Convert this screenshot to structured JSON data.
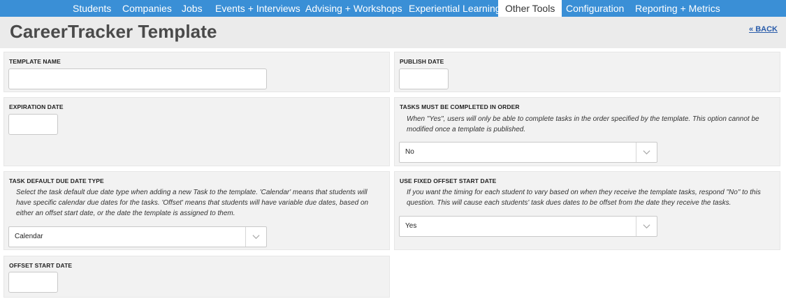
{
  "nav": {
    "tabs": [
      {
        "label": "Students"
      },
      {
        "label": "Companies"
      },
      {
        "label": "Jobs"
      },
      {
        "label": "Events + Interviews"
      },
      {
        "label": "Advising + Workshops"
      },
      {
        "label": "Experiential Learning"
      },
      {
        "label": "Other Tools"
      },
      {
        "label": "Configuration"
      },
      {
        "label": "Reporting + Metrics"
      }
    ],
    "active_tab": "Other Tools"
  },
  "header": {
    "title": "CareerTracker Template",
    "back_label": "« BACK"
  },
  "form": {
    "template_name": {
      "label": "TEMPLATE NAME",
      "value": ""
    },
    "publish_date": {
      "label": "PUBLISH DATE",
      "value": ""
    },
    "expiration_date": {
      "label": "EXPIRATION DATE",
      "value": ""
    },
    "tasks_in_order": {
      "label": "TASKS MUST BE COMPLETED IN ORDER",
      "help_line1": "When \"Yes\", users will only be able to complete tasks in the order specified by the template. This option cannot be",
      "help_line2": "modified once a template is published.",
      "value": "No"
    },
    "task_due_date_type": {
      "label": "TASK DEFAULT DUE DATE TYPE",
      "help_line1": "Select the task default due date type when adding a new Task to the template. 'Calendar' means that students will",
      "help_line2": "have specific calendar due dates for the tasks. 'Offset' means that students will have variable due dates, based on",
      "help_line3": "either an offset start date, or the date the template is assigned to them.",
      "value": "Calendar"
    },
    "fixed_offset_start": {
      "label": "USE FIXED OFFSET START DATE",
      "help_line1": "If you want the timing for each student to vary based on when they receive the template tasks, respond \"No\" to this",
      "help_line2": "question. This will cause each students' task dues dates to be offset from the date they receive the tasks.",
      "value": "Yes"
    },
    "offset_start_date": {
      "label": "OFFSET START DATE",
      "value": ""
    }
  }
}
